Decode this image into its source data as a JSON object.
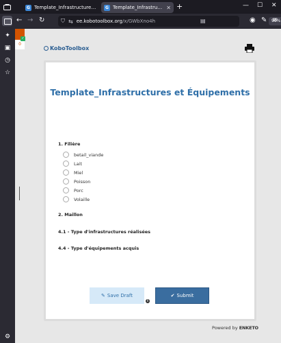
{
  "browser": {
    "tabs": [
      {
        "title": "Template_Infrastructures et Équ"
      },
      {
        "title": "Template_Infrastructures et Équ"
      }
    ],
    "url_domain": "ee.kobotoolbox.org",
    "url_path": "/x/GWbXno4h",
    "zoom": "90%"
  },
  "page": {
    "badge_count": "0",
    "logo": "KoboToolbox",
    "form_title": "Template_Infrastructures et Équipements",
    "questions": [
      {
        "label": "1. Filière"
      },
      {
        "label": "2. Maillon"
      },
      {
        "label": "4.1 - Type d'infrastructures réalisées"
      },
      {
        "label": "4.4 - Type d'équipements acquis"
      }
    ],
    "options": [
      "betail_viande",
      "Lait",
      "Miel",
      "Poisson",
      "Porc",
      "Volaille"
    ],
    "save_draft": "Save Draft",
    "submit": "Submit",
    "powered_by": "Powered by",
    "powered_brand": "ENKETO"
  },
  "colors": {
    "accent": "#2f6fa8",
    "submit_bg": "#3a6d9f",
    "draft_bg": "#d6e9f8"
  }
}
